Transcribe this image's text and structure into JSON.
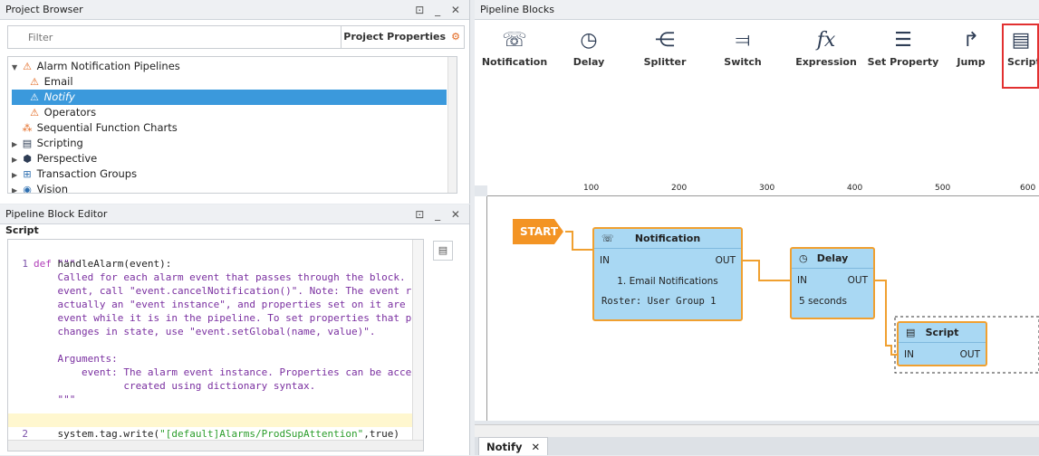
{
  "project_browser": {
    "title": "Project Browser",
    "controls": "⊡ _ ✕",
    "filter_placeholder": "Filter",
    "project_properties": "Project Properties",
    "tree": [
      {
        "label": "Alarm Notification Pipelines",
        "icon": "pipeline-icon"
      },
      {
        "label": "Email",
        "icon": "pipeline-icon"
      },
      {
        "label": "Notify",
        "icon": "pipeline-icon",
        "selected": true
      },
      {
        "label": "Operators",
        "icon": "pipeline-icon"
      },
      {
        "label": "Sequential Function Charts",
        "icon": "sfc-icon"
      },
      {
        "label": "Scripting",
        "icon": "script-icon"
      },
      {
        "label": "Perspective",
        "icon": "perspective-icon"
      },
      {
        "label": "Transaction Groups",
        "icon": "transaction-icon"
      },
      {
        "label": "Vision",
        "icon": "vision-icon"
      }
    ]
  },
  "block_editor": {
    "title": "Pipeline Block Editor",
    "controls": "⊡ _ ✕",
    "section": "Script",
    "code": {
      "line1_num": "1",
      "line1_kw": "def",
      "line1_text": " handleAlarm(event):",
      "doc": [
        "    \"\"\"",
        "    Called for each alarm event that passes through the block.",
        "    event, call \"event.cancelNotification()\". Note: The event r",
        "    actually an \"event instance\", and properties set on it are",
        "    event while it is in the pipeline. To set properties that p",
        "    changes in state, use \"event.setGlobal(name, value)\".",
        "",
        "    Arguments:",
        "        event: The alarm event instance. Properties can be acce",
        "               created using dictionary syntax.",
        "    \"\"\""
      ],
      "line2_num": "2",
      "line2_pre": "    system.tag.write(",
      "line2_str": "\"[default]Alarms/ProdSupAttention\"",
      "line2_post": ",true)"
    }
  },
  "pipeline_blocks": {
    "title": "Pipeline Blocks",
    "items": [
      {
        "label": "Notification",
        "glyph": "☏",
        "icon": "notification-icon"
      },
      {
        "label": "Delay",
        "glyph": "◷",
        "icon": "delay-icon"
      },
      {
        "label": "Splitter",
        "glyph": "⋲",
        "icon": "splitter-icon"
      },
      {
        "label": "Switch",
        "glyph": "⫤",
        "icon": "switch-icon"
      },
      {
        "label": "Expression",
        "glyph": "fx",
        "icon": "expression-icon"
      },
      {
        "label": "Set Property",
        "glyph": "☰",
        "icon": "set-property-icon"
      },
      {
        "label": "Jump",
        "glyph": "↱",
        "icon": "jump-icon"
      },
      {
        "label": "Script",
        "glyph": "▤",
        "icon": "script-icon"
      }
    ]
  },
  "canvas": {
    "ruler_ticks": [
      "100",
      "200",
      "300",
      "400",
      "500",
      "600"
    ],
    "start_label": "START",
    "notification_node": {
      "title": "Notification",
      "in": "IN",
      "out": "OUT",
      "line1": "1. Email Notifications",
      "line2": "Roster: User Group 1"
    },
    "delay_node": {
      "title": "Delay",
      "in": "IN",
      "out": "OUT",
      "line1": "5 seconds"
    },
    "script_node": {
      "title": "Script",
      "in": "IN",
      "out": "OUT"
    },
    "accent_color": "#f0a030",
    "node_color": "#a9d8f3"
  },
  "tabs": [
    {
      "label": "Notify",
      "close": "✕"
    }
  ]
}
